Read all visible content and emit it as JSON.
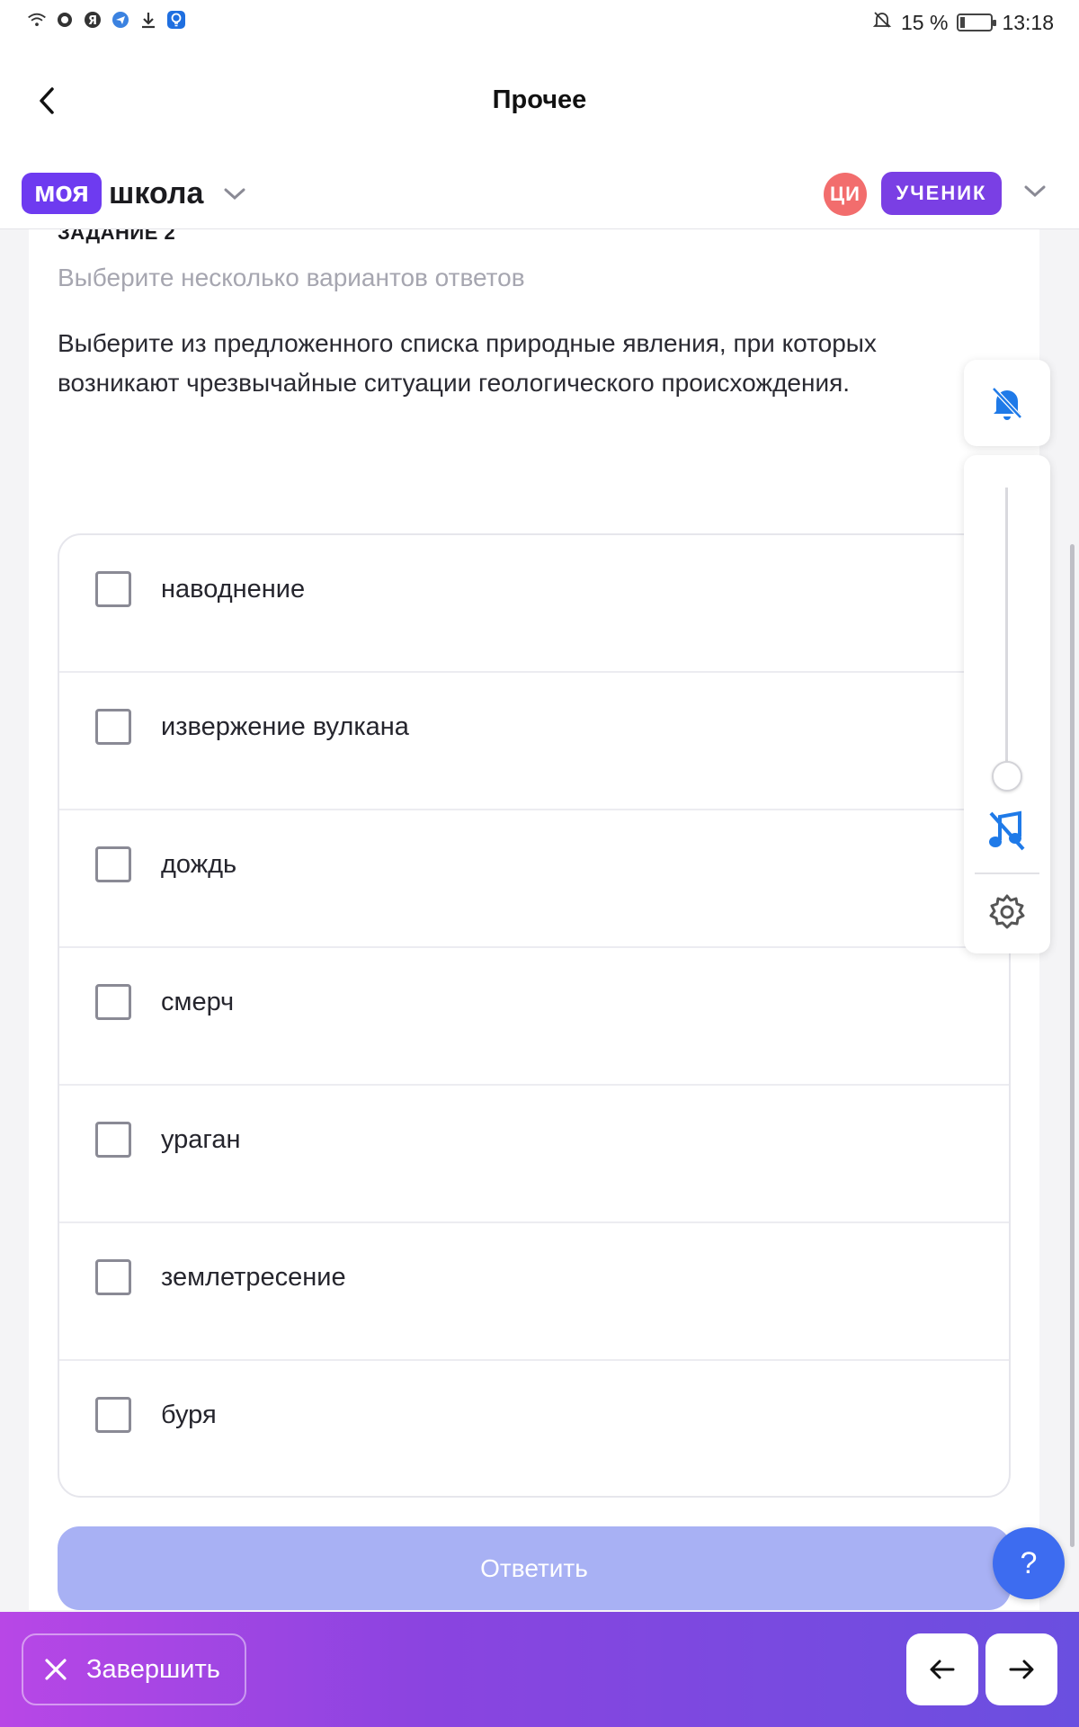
{
  "status_bar": {
    "battery": "15 %",
    "time": "13:18",
    "icons": [
      "wifi-icon",
      "chat-icon",
      "yandex-icon",
      "telegram-icon",
      "download-icon",
      "lightbulb-icon",
      "bell-off-icon",
      "battery-icon"
    ]
  },
  "header": {
    "title": "Прочее"
  },
  "app": {
    "logo_part1": "моя",
    "logo_part2": "школа",
    "avatar_initials": "ЦИ",
    "role_label": "УЧЕНИК",
    "brand_color": "#6e3bf0"
  },
  "task": {
    "label": "ЗАДАНИЕ 2",
    "hint": "Выберите несколько вариантов ответов",
    "question": "Выберите из предложенного списка природные явления, при которых возникают чрезвычайные ситуации геологического происхождения.",
    "options": [
      {
        "label": "наводнение",
        "checked": false
      },
      {
        "label": "извержение вулкана",
        "checked": false
      },
      {
        "label": "дождь",
        "checked": false
      },
      {
        "label": "смерч",
        "checked": false
      },
      {
        "label": "ураган",
        "checked": false
      },
      {
        "label": "землетресение",
        "checked": false
      },
      {
        "label": "буря",
        "checked": false
      }
    ],
    "answer_button": "Ответить"
  },
  "controls": {
    "volume_level": 0,
    "help_label": "?"
  },
  "footer": {
    "finish_label": "Завершить",
    "prev_icon": "arrow-left-icon",
    "next_icon": "arrow-right-icon"
  }
}
